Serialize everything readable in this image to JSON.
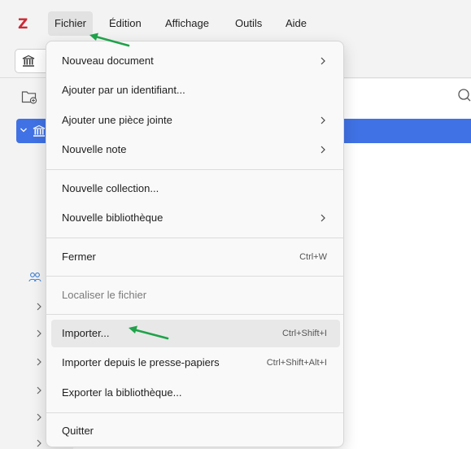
{
  "app": {
    "logo": "Z",
    "logo_color": "#cc2936"
  },
  "menubar": {
    "items": [
      {
        "label": "Fichier",
        "active": true
      },
      {
        "label": "Édition"
      },
      {
        "label": "Affichage"
      },
      {
        "label": "Outils"
      },
      {
        "label": "Aide"
      }
    ]
  },
  "colors": {
    "selection": "#4072e5",
    "annotation_arrow": "#1fa24a",
    "menu_bg": "#f9f9f9"
  },
  "file_menu": {
    "items": [
      {
        "label": "Nouveau document",
        "submenu": true
      },
      {
        "label": "Ajouter par un identifiant..."
      },
      {
        "label": "Ajouter une pièce jointe",
        "submenu": true
      },
      {
        "label": "Nouvelle note",
        "submenu": true
      },
      {
        "label": "Nouvelle collection..."
      },
      {
        "label": "Nouvelle bibliothèque",
        "submenu": true
      },
      {
        "label": "Fermer",
        "shortcut": "Ctrl+W"
      },
      {
        "label": "Localiser le fichier",
        "disabled": true
      },
      {
        "label": "Importer...",
        "shortcut": "Ctrl+Shift+I",
        "highlighted": true
      },
      {
        "label": "Importer depuis le presse-papiers",
        "shortcut": "Ctrl+Shift+Alt+I"
      },
      {
        "label": "Exporter la bibliothèque..."
      },
      {
        "label": "Quitter"
      }
    ]
  },
  "icons": {
    "tab": "library-icon",
    "new_collection": "new-collection-icon",
    "search": "search-icon",
    "group": "group-icon",
    "chevron": "chevron-right-icon"
  }
}
